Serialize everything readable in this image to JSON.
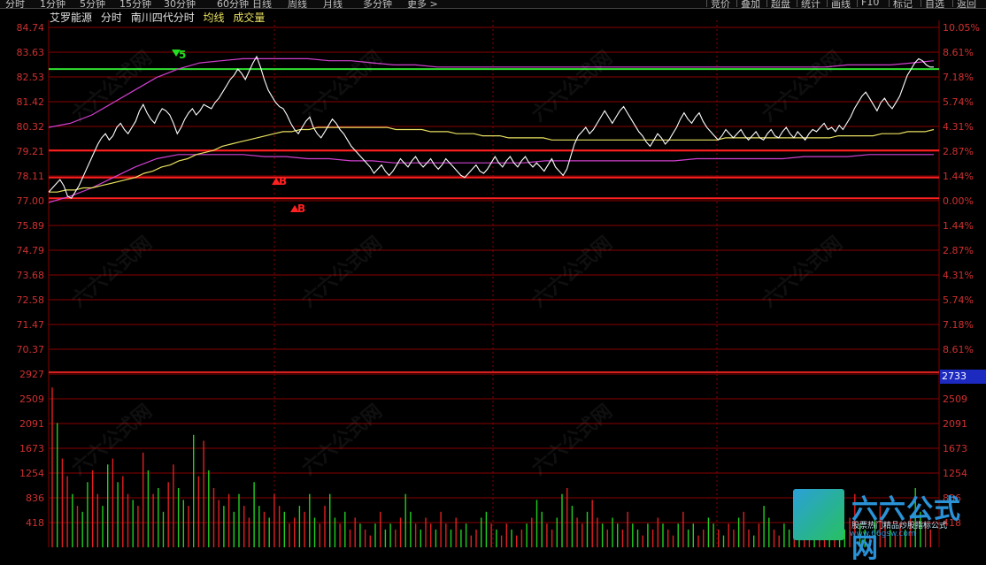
{
  "toolbar": {
    "period_tabs": [
      "分时",
      "1分钟",
      "5分钟",
      "15分钟",
      "30分钟",
      "60分钟",
      "日线",
      "周线",
      "月线",
      "多分钟",
      "更多 >"
    ],
    "right_buttons": [
      "竞价",
      "叠加",
      "超盘",
      "统计",
      "画线",
      "F10",
      "标记",
      "自选",
      "返回"
    ]
  },
  "header": {
    "stock_name": "艾罗能源",
    "view": "分时",
    "indicator_name": "南川四代分时",
    "avg_legend": "均线",
    "volume_legend": "成交量"
  },
  "colors": {
    "price_line": "#ffffff",
    "avg_line": "#e8e060",
    "band_line": "#d040d0",
    "support_line": "#30e030",
    "level_line": "#ff2020",
    "grid": "#8a0000",
    "vol_up": "#e02020",
    "vol_down": "#20d020"
  },
  "price_axis": {
    "left_labels": [
      "84.74",
      "83.63",
      "82.53",
      "81.42",
      "80.32",
      "79.21",
      "78.11",
      "77.00",
      "75.89",
      "74.79",
      "73.68",
      "72.58",
      "71.47",
      "70.37"
    ],
    "right_labels": [
      "10.05%",
      "8.61%",
      "7.18%",
      "5.74%",
      "4.31%",
      "2.87%",
      "1.44%",
      "0.00%",
      "1.44%",
      "2.87%",
      "4.31%",
      "5.74%",
      "7.18%",
      "8.61%"
    ],
    "base_price": 77.0
  },
  "volume_axis": {
    "left_labels": [
      "2927",
      "2509",
      "2091",
      "1673",
      "1254",
      "836",
      "418"
    ],
    "right_labels": [
      "2733",
      "2509",
      "2091",
      "1673",
      "1254",
      "836",
      "418"
    ]
  },
  "markers": [
    {
      "text": "5",
      "color": "#20e020",
      "position": "above"
    },
    {
      "text": "B",
      "color": "#ff2020",
      "position": "below"
    },
    {
      "text": "B",
      "color": "#ff2020",
      "position": "below"
    }
  ],
  "chart_data": {
    "type": "line",
    "series": [
      {
        "name": "分时",
        "values": [
          77.3,
          77.5,
          77.7,
          77.9,
          77.6,
          77.1,
          77.0,
          77.3,
          77.6,
          78.0,
          78.4,
          78.8,
          79.2,
          79.6,
          79.9,
          80.1,
          79.8,
          80.0,
          80.4,
          80.6,
          80.3,
          80.1,
          80.4,
          80.7,
          81.2,
          81.5,
          81.1,
          80.8,
          80.6,
          81.0,
          81.3,
          81.2,
          81.0,
          80.6,
          80.1,
          80.4,
          80.8,
          81.1,
          81.3,
          81.0,
          81.2,
          81.5,
          81.4,
          81.3,
          81.6,
          81.8,
          82.1,
          82.4,
          82.7,
          82.9,
          83.2,
          83.0,
          82.7,
          83.1,
          83.5,
          83.8,
          83.3,
          82.7,
          82.2,
          81.9,
          81.6,
          81.4,
          81.3,
          81.0,
          80.6,
          80.3,
          80.1,
          80.4,
          80.7,
          80.9,
          80.4,
          80.1,
          79.9,
          80.2,
          80.5,
          80.8,
          80.6,
          80.3,
          80.1,
          79.8,
          79.5,
          79.3,
          79.1,
          78.9,
          78.7,
          78.5,
          78.2,
          78.4,
          78.6,
          78.3,
          78.1,
          78.3,
          78.6,
          78.9,
          78.7,
          78.5,
          78.8,
          79.0,
          78.7,
          78.5,
          78.7,
          78.9,
          78.6,
          78.4,
          78.6,
          78.9,
          78.7,
          78.5,
          78.3,
          78.1,
          78.0,
          78.2,
          78.4,
          78.6,
          78.3,
          78.2,
          78.4,
          78.7,
          79.0,
          78.7,
          78.5,
          78.8,
          79.0,
          78.7,
          78.5,
          78.8,
          79.0,
          78.7,
          78.5,
          78.7,
          78.5,
          78.3,
          78.6,
          78.9,
          78.5,
          78.3,
          78.1,
          78.4,
          79.0,
          79.6,
          80.0,
          80.2,
          80.4,
          80.1,
          80.3,
          80.6,
          80.9,
          81.2,
          80.9,
          80.6,
          80.9,
          81.2,
          81.4,
          81.1,
          80.8,
          80.5,
          80.2,
          80.0,
          79.7,
          79.5,
          79.8,
          80.1,
          79.9,
          79.6,
          79.8,
          80.1,
          80.4,
          80.8,
          81.1,
          80.8,
          80.6,
          80.9,
          81.1,
          80.7,
          80.4,
          80.2,
          80.0,
          79.8,
          80.0,
          80.3,
          80.1,
          79.9,
          80.1,
          80.3,
          80.0,
          79.8,
          80.0,
          80.2,
          79.9,
          79.8,
          80.1,
          80.3,
          80.0,
          79.9,
          80.2,
          80.4,
          80.1,
          79.9,
          80.2,
          80.0,
          79.8,
          80.1,
          80.3,
          80.2,
          80.4,
          80.6,
          80.3,
          80.4,
          80.2,
          80.5,
          80.3,
          80.6,
          80.9,
          81.3,
          81.6,
          81.9,
          82.1,
          81.8,
          81.5,
          81.2,
          81.6,
          81.8,
          81.5,
          81.3,
          81.6,
          81.9,
          82.4,
          82.9,
          83.2,
          83.5,
          83.7,
          83.6,
          83.4,
          83.3,
          83.3
        ]
      },
      {
        "name": "均线",
        "values": [
          77.3,
          77.3,
          77.4,
          77.4,
          77.5,
          77.5,
          77.6,
          77.7,
          77.8,
          77.9,
          78.0,
          78.2,
          78.3,
          78.5,
          78.6,
          78.8,
          78.9,
          79.1,
          79.2,
          79.3,
          79.5,
          79.6,
          79.7,
          79.8,
          79.9,
          80.0,
          80.1,
          80.2,
          80.2,
          80.3,
          80.3,
          80.4,
          80.4,
          80.4,
          80.4,
          80.4,
          80.4,
          80.4,
          80.4,
          80.4,
          80.3,
          80.3,
          80.3,
          80.3,
          80.2,
          80.2,
          80.2,
          80.1,
          80.1,
          80.1,
          80.0,
          80.0,
          80.0,
          79.9,
          79.9,
          79.9,
          79.9,
          79.9,
          79.8,
          79.8,
          79.8,
          79.8,
          79.8,
          79.8,
          79.8,
          79.8,
          79.8,
          79.8,
          79.8,
          79.8,
          79.8,
          79.8,
          79.8,
          79.8,
          79.8,
          79.8,
          79.8,
          79.8,
          79.9,
          79.9,
          79.9,
          79.9,
          79.9,
          79.9,
          79.9,
          79.9,
          79.9,
          79.9,
          79.9,
          79.9,
          79.9,
          80.0,
          80.0,
          80.0,
          80.0,
          80.0,
          80.1,
          80.1,
          80.1,
          80.2,
          80.2,
          80.2,
          80.3
        ]
      },
      {
        "name": "上轨",
        "values": [
          80.4,
          80.6,
          81.0,
          81.6,
          82.2,
          82.8,
          83.2,
          83.5,
          83.6,
          83.7,
          83.7,
          83.7,
          83.7,
          83.6,
          83.6,
          83.5,
          83.4,
          83.4,
          83.3,
          83.3,
          83.3,
          83.3,
          83.3,
          83.3,
          83.3,
          83.3,
          83.3,
          83.3,
          83.3,
          83.3,
          83.3,
          83.3,
          83.3,
          83.3,
          83.3,
          83.3,
          83.3,
          83.4,
          83.4,
          83.4,
          83.5,
          83.6
        ]
      },
      {
        "name": "下轨",
        "values": [
          76.8,
          77.1,
          77.5,
          78.0,
          78.5,
          78.9,
          79.1,
          79.1,
          79.1,
          79.1,
          79.0,
          79.0,
          78.9,
          78.9,
          78.8,
          78.8,
          78.7,
          78.7,
          78.7,
          78.7,
          78.7,
          78.7,
          78.7,
          78.8,
          78.8,
          78.8,
          78.8,
          78.8,
          78.8,
          78.8,
          78.9,
          78.9,
          78.9,
          78.9,
          78.9,
          79.0,
          79.0,
          79.0,
          79.1,
          79.1,
          79.1,
          79.1
        ]
      },
      {
        "name": "成交量",
        "values": [
          2700,
          2100,
          1500,
          1200,
          900,
          700,
          600,
          1100,
          1300,
          900,
          700,
          1400,
          1500,
          1100,
          1200,
          900,
          800,
          700,
          1600,
          1300,
          900,
          1000,
          600,
          1100,
          1400,
          1000,
          800,
          700,
          1900,
          1200,
          1800,
          1300,
          1000,
          800,
          700,
          900,
          600,
          900,
          700,
          500,
          1100,
          700,
          600,
          500,
          900,
          700,
          600,
          400,
          500,
          700,
          600,
          900,
          500,
          400,
          700,
          900,
          500,
          400,
          600,
          300,
          500,
          400,
          300,
          200,
          400,
          600,
          300,
          400,
          300,
          500,
          900,
          600,
          400,
          300,
          500,
          400,
          300,
          600,
          400,
          300,
          500,
          300,
          400,
          200,
          300,
          500,
          600,
          400,
          300,
          200,
          400,
          300,
          200,
          300,
          400,
          500,
          800,
          600,
          400,
          300,
          500,
          900,
          1000,
          700,
          500,
          400,
          600,
          800,
          500,
          400,
          300,
          500,
          400,
          300,
          600,
          400,
          300,
          200,
          400,
          300,
          500,
          400,
          300,
          200,
          400,
          600,
          300,
          400,
          200,
          300,
          500,
          400,
          300,
          200,
          400,
          300,
          500,
          600,
          300,
          200,
          400,
          700,
          500,
          300,
          200,
          400,
          300,
          600,
          400,
          300,
          200,
          400,
          500,
          300,
          200,
          400,
          600,
          300,
          500,
          900,
          400,
          300,
          200,
          500,
          700,
          400,
          300,
          200,
          400,
          300,
          500,
          1000,
          600,
          400,
          300
        ]
      }
    ],
    "price_range": [
      69.8,
      85.2
    ],
    "volume_range": [
      0,
      2927
    ],
    "horizontal_levels": [
      {
        "name": "support_green",
        "value": 83.2
      },
      {
        "name": "level_red_1",
        "value": 79.3
      },
      {
        "name": "level_red_2",
        "value": 78.0
      },
      {
        "name": "level_red_3",
        "value": 77.0
      }
    ]
  },
  "watermark": {
    "text": "六六公式网",
    "logo_big": "六六公式网",
    "logo_sub": "股票热门精品炒股指标公式",
    "logo_url": "www.66gsw.com"
  }
}
